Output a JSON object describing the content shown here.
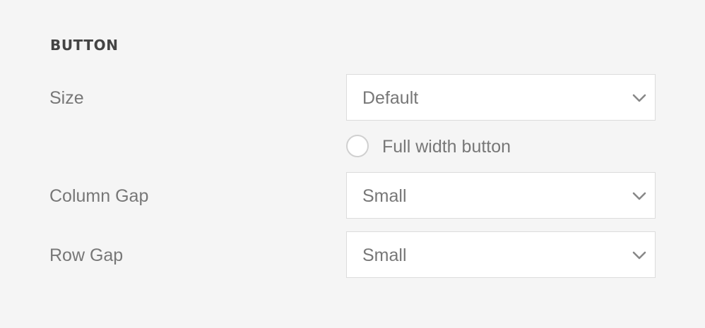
{
  "section": {
    "title": "BUTTON"
  },
  "fields": {
    "size": {
      "label": "Size",
      "value": "Default"
    },
    "full_width": {
      "label": "Full width button",
      "checked": false
    },
    "column_gap": {
      "label": "Column Gap",
      "value": "Small"
    },
    "row_gap": {
      "label": "Row Gap",
      "value": "Small"
    }
  },
  "icons": {
    "select_arrow": "chevron-down-icon"
  },
  "colors": {
    "background": "#f5f5f5",
    "field_background": "#ffffff",
    "border": "#dcdcdc",
    "text": "#777777",
    "heading": "#444444"
  }
}
